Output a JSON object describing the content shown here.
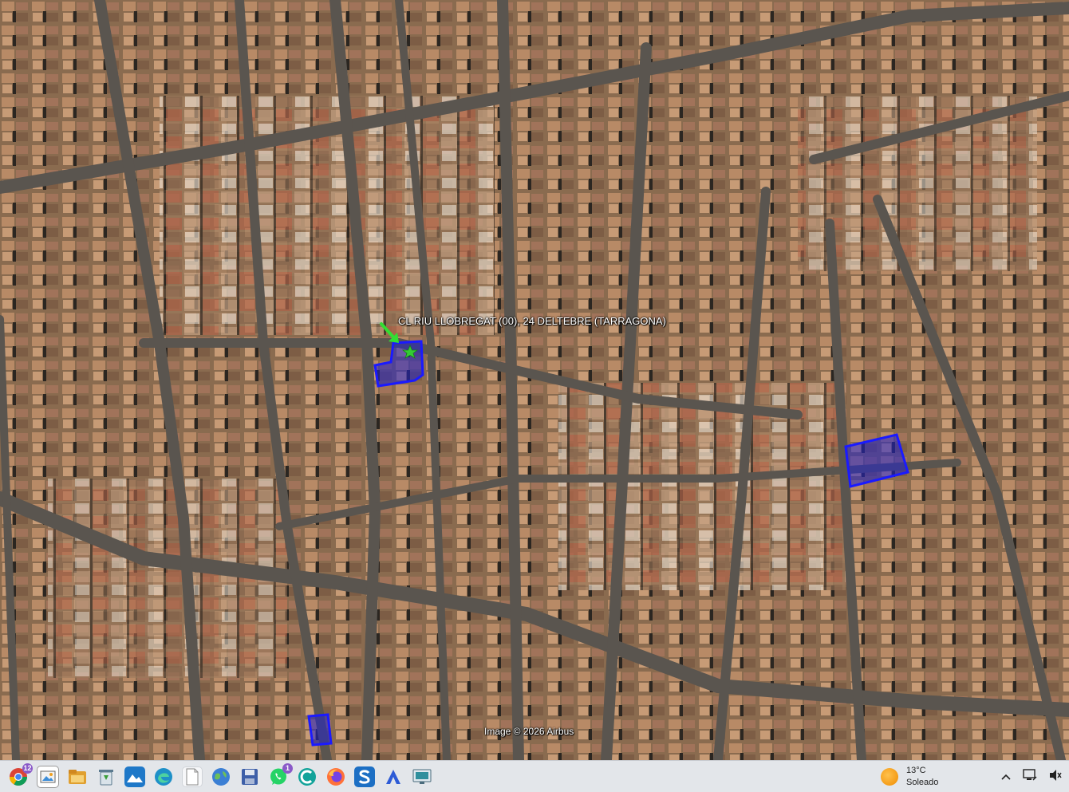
{
  "map": {
    "type": "satellite",
    "address_label": "CL RIU LLOBREGAT (00), 24  DELTEBRE (TARRAGONA)",
    "attribution": "Image © 2026 Airbus",
    "colors": {
      "parcel_outline": "#1a1aff",
      "parcel_fill": "#2222cc",
      "marker_arrow": "#33dd33",
      "marker_star": "#33cc33"
    }
  },
  "taskbar": {
    "apps": [
      {
        "name": "chrome-icon",
        "badge": "12"
      },
      {
        "name": "gallery-icon",
        "badge": ""
      },
      {
        "name": "file-explorer-icon",
        "badge": ""
      },
      {
        "name": "recycle-icon",
        "badge": ""
      },
      {
        "name": "photos-icon",
        "badge": ""
      },
      {
        "name": "edge-icon",
        "badge": ""
      },
      {
        "name": "document-icon",
        "badge": ""
      },
      {
        "name": "google-earth-icon",
        "badge": ""
      },
      {
        "name": "save-icon",
        "badge": ""
      },
      {
        "name": "whatsapp-icon",
        "badge": "1"
      },
      {
        "name": "app-c-icon",
        "badge": ""
      },
      {
        "name": "firefox-icon",
        "badge": ""
      },
      {
        "name": "app-s-icon",
        "badge": ""
      },
      {
        "name": "app-a-icon",
        "badge": ""
      },
      {
        "name": "monitor-icon",
        "badge": ""
      }
    ],
    "weather": {
      "temperature": "13°C",
      "condition": "Soleado"
    },
    "tray": [
      "chevron-up-icon",
      "network-icon",
      "volume-icon"
    ]
  }
}
